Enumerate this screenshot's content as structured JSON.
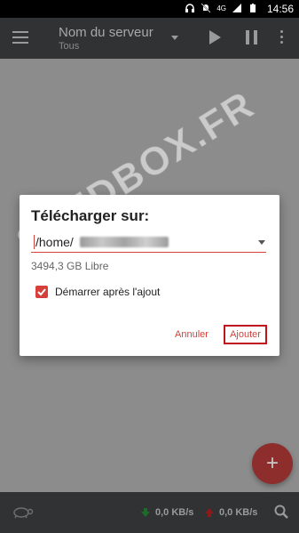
{
  "status_bar": {
    "time": "14:56",
    "network_label": "4G"
  },
  "app_bar": {
    "server_name": "Nom du serveur",
    "filter": "Tous"
  },
  "dialog": {
    "title": "Télécharger sur:",
    "path": "/home/",
    "free_space": "3494,3 GB Libre",
    "start_after_add_label": "Démarrer après l'ajout",
    "start_after_add_checked": true,
    "cancel_label": "Annuler",
    "add_label": "Ajouter"
  },
  "fab": {
    "label": "+"
  },
  "bottom_bar": {
    "download_speed": "0,0 KB/s",
    "upload_speed": "0,0 KB/s"
  },
  "watermark": "SEEDBOX.FR",
  "colors": {
    "accent": "#d5403a",
    "toolbar": "#303234",
    "download_arrow": "#1e6b2a",
    "upload_arrow": "#8b1a1a"
  }
}
